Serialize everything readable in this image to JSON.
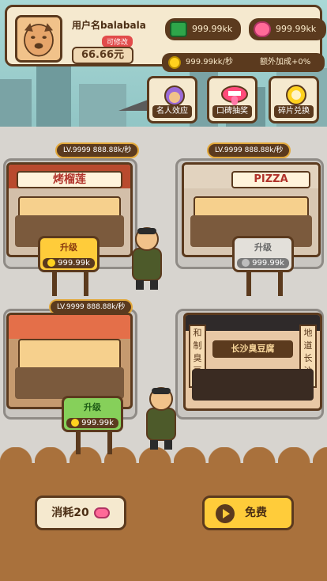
{
  "top": {
    "username": "用户名balabala",
    "edit": "可修改",
    "money": "66.66元",
    "cash": "999.99kk",
    "lips": "999.99kk",
    "rate": "999.99kk/秒",
    "bonus": "额外加成+0%"
  },
  "features": [
    {
      "label": "名人效应",
      "icon": "purple-hair-celebrity-icon"
    },
    {
      "label": "口碑抽奖",
      "icon": "lips-tongue-icon"
    },
    {
      "label": "碎片兑换",
      "icon": "gold-coin-fragment-icon"
    }
  ],
  "shops": [
    {
      "name": "烤榴莲",
      "level": "LV.9999 888.88k/秒",
      "upgrade": {
        "label": "升级",
        "value": "999.99k",
        "state": "available"
      }
    },
    {
      "name": "PIZZA",
      "level": "LV.9999 888.88k/秒",
      "upgrade": {
        "label": "升级",
        "value": "999.99k",
        "state": "disabled"
      }
    },
    {
      "name": "",
      "level": "LV.9999 888.88k/秒",
      "upgrade": {
        "label": "升级",
        "value": "999.99k",
        "state": "affordable"
      }
    },
    {
      "name": "长沙臭豆腐",
      "level": "",
      "side_left": "和制臭豆腐",
      "side_right": "地道长沙"
    }
  ],
  "bottom": {
    "consume": "消耗20",
    "free": "免费"
  },
  "colors": {
    "brown": "#5b3a1e",
    "cream": "#f5e9cf",
    "yellow": "#ffcc3a",
    "green": "#86d05a",
    "pink": "#ff6a98"
  }
}
